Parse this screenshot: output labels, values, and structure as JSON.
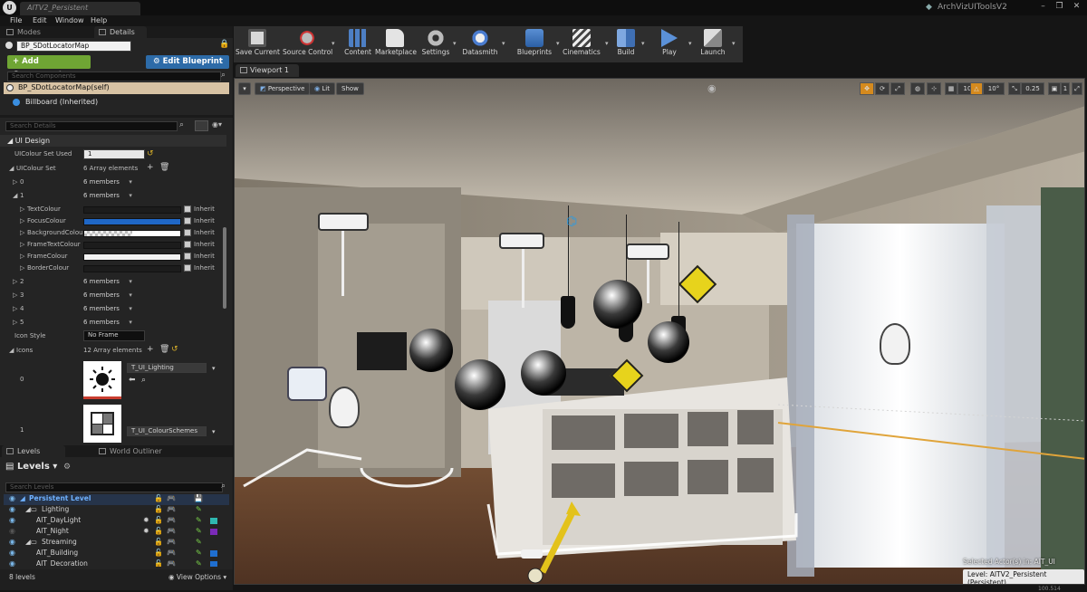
{
  "window": {
    "doc_tab": "AITV2_Persistent",
    "project": "ArchVizUIToolsV2",
    "logo": "U",
    "min": "–",
    "max": "❐",
    "close": "✕"
  },
  "menu": [
    "File",
    "Edit",
    "Window",
    "Help"
  ],
  "left_tabs": {
    "modes": "Modes",
    "details": "Details"
  },
  "blueprint": {
    "name": "BP_SDotLocatorMap"
  },
  "components": {
    "add_label": "+ Add Component ▾",
    "edit_label": "⚙ Edit Blueprint ▾",
    "search_placeholder": "Search Components",
    "items": [
      "BP_SDotLocatorMap(self)",
      "Billboard (Inherited)"
    ]
  },
  "details": {
    "search_placeholder": "Search Details",
    "category": "UI Design",
    "ui_colour_set_used": {
      "label": "UIColour Set Used",
      "value": "1"
    },
    "ui_colour_set": {
      "label": "UIColour Set",
      "summary": "6 Array elements"
    },
    "members_label": "6 members",
    "index_0": "0",
    "index_1": "1",
    "colours": [
      {
        "name": "TextColour",
        "color": "#1c1c1c",
        "inherit": "Inherit"
      },
      {
        "name": "FocusColour",
        "color": "#1f67c6",
        "inherit": "Inherit"
      },
      {
        "name": "BackgroundColour",
        "color": "checker",
        "inherit": "Inherit"
      },
      {
        "name": "FrameTextColour",
        "color": "#1c1c1c",
        "inherit": "Inherit"
      },
      {
        "name": "FrameColour",
        "color": "#f2f2f2",
        "inherit": "Inherit"
      },
      {
        "name": "BorderColour",
        "color": "#1c1c1c",
        "inherit": "Inherit"
      }
    ],
    "more_indices": [
      "2",
      "3",
      "4",
      "5"
    ],
    "icon_style": {
      "label": "Icon Style",
      "value": "No Frame"
    },
    "icons": {
      "label": "Icons",
      "summary": "12 Array elements"
    },
    "icon_items": [
      {
        "index": "0",
        "texture": "T_UI_Lighting",
        "icon": "sun-icon"
      },
      {
        "index": "1",
        "texture": "T_UI_ColourSchemes",
        "icon": "colour-schemes-icon"
      }
    ]
  },
  "bottom_tabs": {
    "levels": "Levels",
    "outliner": "World Outliner"
  },
  "levels": {
    "header": "Levels ▾",
    "search_placeholder": "Search Levels",
    "rows": [
      {
        "name": "Persistent Level",
        "color": ""
      },
      {
        "name": "Lighting",
        "color": ""
      },
      {
        "name": "AIT_DayLight",
        "color": "#2fb8b0"
      },
      {
        "name": "AIT_Night",
        "color": "#7b2ab8"
      },
      {
        "name": "Streaming",
        "color": ""
      },
      {
        "name": "AIT_Building",
        "color": "#1f6fd0"
      },
      {
        "name": "AIT_Decoration",
        "color": "#1f6fd0"
      }
    ],
    "count": "8 levels",
    "view_options": "◉ View Options ▾"
  },
  "toolbar": [
    {
      "label": "Save Current",
      "icon": "save-icon"
    },
    {
      "label": "Source Control",
      "icon": "source-control-icon"
    },
    {
      "label": "Content",
      "icon": "content-icon"
    },
    {
      "label": "Marketplace",
      "icon": "marketplace-icon"
    },
    {
      "label": "Settings",
      "icon": "settings-icon"
    },
    {
      "label": "Datasmith",
      "icon": "datasmith-icon"
    },
    {
      "label": "Blueprints",
      "icon": "blueprints-icon"
    },
    {
      "label": "Cinematics",
      "icon": "cinematics-icon"
    },
    {
      "label": "Build",
      "icon": "build-icon"
    },
    {
      "label": "Play",
      "icon": "play-icon"
    },
    {
      "label": "Launch",
      "icon": "launch-icon"
    }
  ],
  "viewport": {
    "tab": "Viewport 1",
    "perspective": "Perspective",
    "lit": "Lit",
    "show": "Show",
    "grid_snap": "10",
    "rot_snap": "10°",
    "scale_snap": "0.25",
    "cam_speed": "1",
    "selected_actor": "Selected Actor(s) in:  AIT_UI",
    "level": "Level:  AITV2_Persistent (Persistent)",
    "footer_partial": "100.514"
  }
}
